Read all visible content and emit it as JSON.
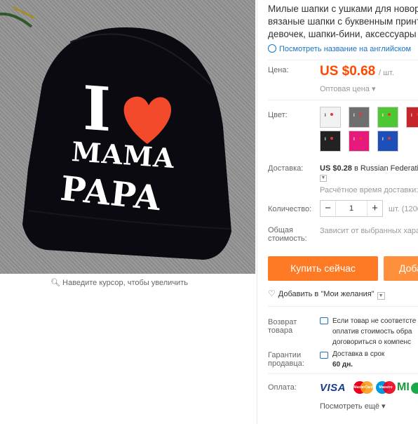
{
  "product": {
    "title": "Милые шапки с ушками для новорожд вязаные шапки с буквенным принт и девочек, шапки-бини, аксессуары",
    "translate_link": "Посмотреть название на английском",
    "image_text": {
      "line1": "I",
      "line2": "MAMA",
      "line3": "PAPA"
    },
    "zoom_hint": "Наведите курсор, чтобы увеличить"
  },
  "price": {
    "label": "Цена:",
    "value": "US $0.68",
    "unit": "/ шт.",
    "wholesale": "Оптовая цена"
  },
  "color": {
    "label": "Цвет:",
    "swatches": [
      {
        "name": "white",
        "bg": "#f2f2f2"
      },
      {
        "name": "gray",
        "bg": "#6e6e6e"
      },
      {
        "name": "green",
        "bg": "#4dc832"
      },
      {
        "name": "red",
        "bg": "#c6262a"
      },
      {
        "name": "black",
        "bg": "#222222"
      },
      {
        "name": "pink",
        "bg": "#e8197c"
      },
      {
        "name": "blue",
        "bg": "#1e4fb8"
      }
    ]
  },
  "shipping": {
    "label": "Доставка:",
    "price": "US $0.28",
    "method": "в Russian Federation",
    "time": "Расчётное время доставки:"
  },
  "quantity": {
    "label": "Количество:",
    "minus": "−",
    "value": "1",
    "plus": "+",
    "available": "шт. (1200"
  },
  "total": {
    "label": "Общая стоимость:",
    "value": "Зависит от выбранных хара"
  },
  "actions": {
    "buy_now": "Купить сейчас",
    "add_to_cart": "Доба",
    "wishlist": "Добавить в \"Мои желания\""
  },
  "returns": {
    "label": "Возврат товара",
    "lines": [
      "Если товар не соответсте",
      "оплатив стоимость обра",
      "договориться о компенс"
    ]
  },
  "guarantee": {
    "label": "Гарантии продавца:",
    "text": "Доставка в срок",
    "days": "60 дн."
  },
  "payment": {
    "label": "Оплата:",
    "visa": "VISA",
    "more_logo": "MI",
    "see_more": "Посмотреть ещё"
  },
  "colors": {
    "accent": "#ff4800",
    "buy": "#ff7a24",
    "link": "#1a73c4"
  }
}
